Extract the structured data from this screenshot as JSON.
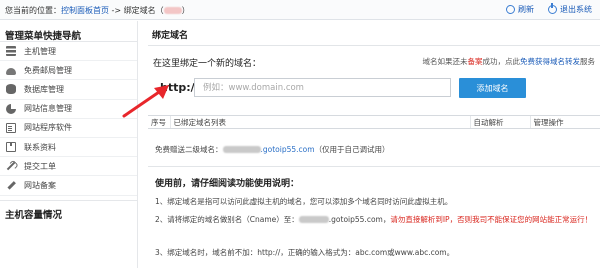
{
  "topbar": {
    "crumb_prefix": "您当前的位置：",
    "crumb_link": "控制面板首页",
    "crumb_sep": " -> ",
    "crumb_current": "绑定域名（",
    "crumb_close": "）",
    "refresh_label": "刷新",
    "logout_label": "退出系统"
  },
  "sidebar": {
    "title": "管理菜单快捷导航",
    "items": [
      {
        "label": "主机管理",
        "icon": "server-icon"
      },
      {
        "label": "免费邮局管理",
        "icon": "cloud-icon"
      },
      {
        "label": "数据库管理",
        "icon": "database-icon"
      },
      {
        "label": "网站信息管理",
        "icon": "pie-chart-icon"
      },
      {
        "label": "网站程序软件",
        "icon": "document-icon"
      },
      {
        "label": "联系资料",
        "icon": "package-icon"
      },
      {
        "label": "提交工单",
        "icon": "wrench-icon"
      },
      {
        "label": "网站备案",
        "icon": "pen-icon"
      }
    ],
    "section2_title": "主机容量情况"
  },
  "main": {
    "title": "绑定域名",
    "bind_title": "在这里绑定一个新的域名：",
    "hint_prefix": "域名如果还未",
    "hint_red": "备案",
    "hint_mid": "成功，点此",
    "hint_link": "免费获得域名转发",
    "hint_suffix": "服务",
    "http_label": "http://",
    "input_placeholder": "例如：www.domain.com",
    "input_value": "",
    "add_button": "添加域名",
    "table_headers": [
      "序号",
      "已绑定域名列表",
      "自动解析",
      "管理操作"
    ],
    "free_prefix": "免费赠送二级域名：",
    "free_domain": ".gotoip55.com",
    "free_suffix": "（仅用于自己调试用）",
    "notice_title": "使用前，请仔细阅读功能使用说明：",
    "note1": "1、绑定域名是指可以访问此虚拟主机的域名，您可以添加多个域名同时访问此虚拟主机。",
    "note2_prefix": "2、请将绑定的域名做别名（Cname）至：",
    "note2_domain": ".gotoip55.com，",
    "note2_red": "请勿直接解析到IP，否则我司不能保证您的网站能正常运行！",
    "note3": "3、绑定域名时，域名前不加：http://，正确的输入格式为：abc.com或www.abc.com。"
  },
  "colors": {
    "accent": "#2a8fd8",
    "link": "#1a5bb8",
    "warning": "#d9251d",
    "arrow": "#e8262b"
  }
}
